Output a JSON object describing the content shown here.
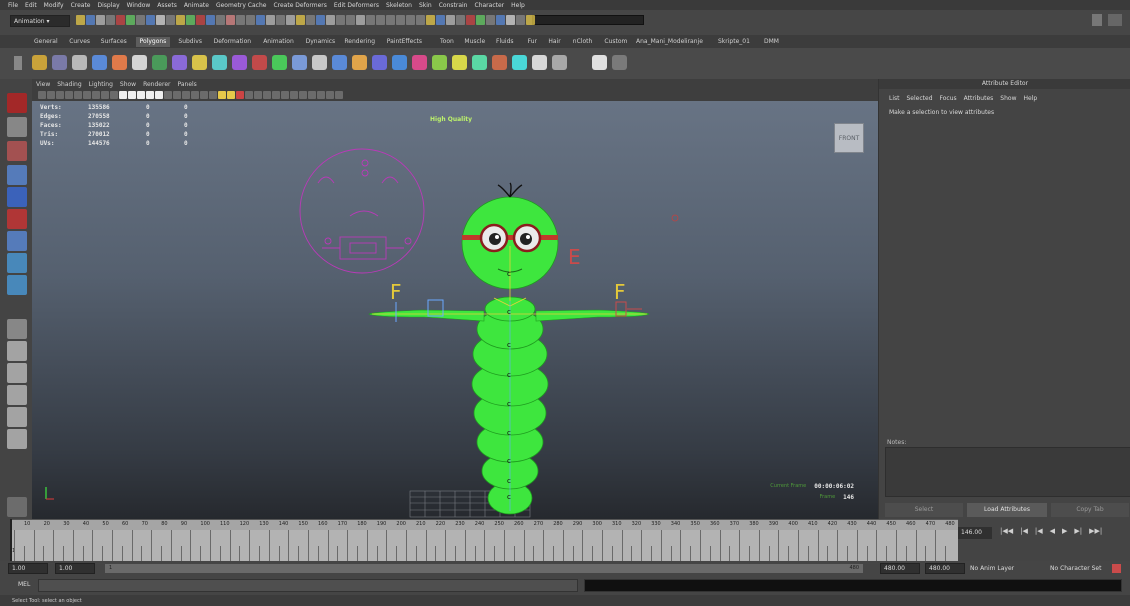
{
  "menubar": [
    "File",
    "Edit",
    "Modify",
    "Create",
    "Display",
    "Window",
    "Assets",
    "Animate",
    "Geometry Cache",
    "Create Deformers",
    "Edit Deformers",
    "Skeleton",
    "Skin",
    "Constrain",
    "Character",
    "Help"
  ],
  "statusline": {
    "mode": "Animation"
  },
  "shelf_tabs": [
    "General",
    "Curves",
    "Surfaces",
    "Polygons",
    "Subdivs",
    "Deformation",
    "Animation",
    "Dynamics",
    "Rendering",
    "PaintEffects",
    "Toon",
    "Muscle",
    "Fluids",
    "Fur",
    "Hair",
    "nCloth",
    "Custom",
    "Ana_Mani_Modeliranje",
    "Skripte_01",
    "DMM"
  ],
  "shelf_active_tab": "Polygons",
  "viewport": {
    "menu": [
      "View",
      "Shading",
      "Lighting",
      "Show",
      "Renderer",
      "Panels"
    ],
    "stats": [
      {
        "label": "Verts:",
        "values": [
          "135586",
          "0",
          "0"
        ]
      },
      {
        "label": "Edges:",
        "values": [
          "270558",
          "0",
          "0"
        ]
      },
      {
        "label": "Faces:",
        "values": [
          "135022",
          "0",
          "0"
        ]
      },
      {
        "label": "Tris:",
        "values": [
          "270012",
          "0",
          "0"
        ]
      },
      {
        "label": "UVs:",
        "values": [
          "144576",
          "0",
          "0"
        ]
      }
    ],
    "quality_label": "High Quality",
    "viewcube_label": "FRONT",
    "time_label": "Current Frame",
    "timecode": "00:00:06:02",
    "frame_label": "Frame",
    "frame": "146",
    "controller_letters": {
      "left_f": "F",
      "right_f": "F",
      "e": "E"
    }
  },
  "attribute_editor": {
    "title": "Attribute Editor",
    "menu": [
      "List",
      "Selected",
      "Focus",
      "Attributes",
      "Show",
      "Help"
    ],
    "message": "Make a selection to view attributes",
    "notes_label": "Notes:",
    "buttons": [
      "Select",
      "Load Attributes",
      "Copy Tab"
    ]
  },
  "timeslider": {
    "ticks": [
      "10",
      "20",
      "30",
      "40",
      "50",
      "60",
      "70",
      "80",
      "90",
      "100",
      "110",
      "120",
      "130",
      "140",
      "150",
      "160",
      "170",
      "180",
      "190",
      "200",
      "210",
      "220",
      "230",
      "240",
      "250",
      "260",
      "270",
      "280",
      "290",
      "300",
      "310",
      "320",
      "330",
      "340",
      "350",
      "360",
      "370",
      "380",
      "390",
      "400",
      "410",
      "420",
      "430",
      "440",
      "450",
      "460",
      "470",
      "480"
    ],
    "current": "146.00",
    "current_marker": "1"
  },
  "rangeslider": {
    "start": "1.00",
    "start2": "1.00",
    "end_inner": "480",
    "end": "480.00",
    "end2": "480.00",
    "anim_layer": "No Anim Layer",
    "char_set": "No Character Set",
    "range_marker": "1"
  },
  "cmdline": {
    "label": "MEL"
  },
  "helpline": "Select Tool: select an object",
  "colors": {
    "accent": "#c94b4b",
    "character": "#3ee63e",
    "highlight_text": "#bdf36b"
  }
}
